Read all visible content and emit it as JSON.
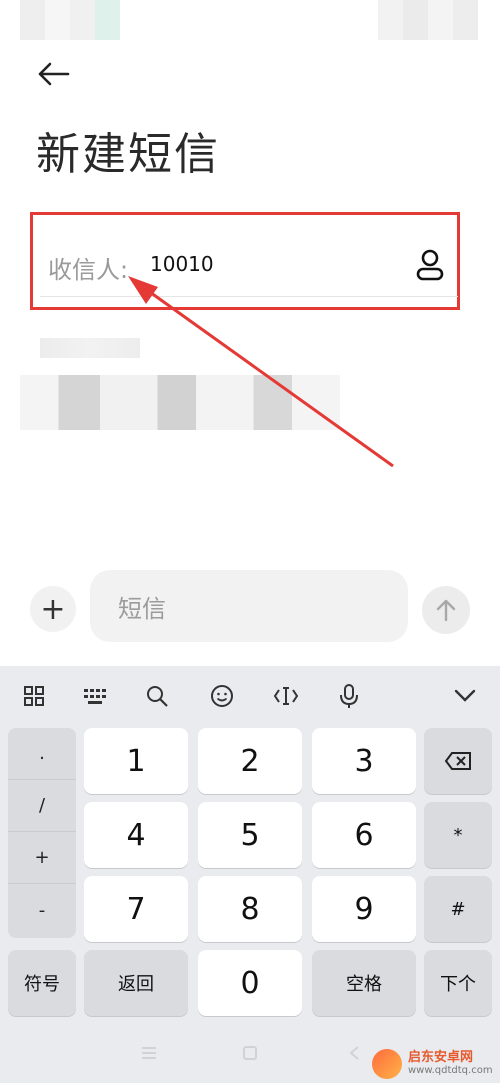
{
  "header": {
    "title": "新建短信"
  },
  "recipient": {
    "label": "收信人:",
    "value": "10010"
  },
  "composer": {
    "placeholder": "短信",
    "plus_label": "+"
  },
  "keyboard": {
    "symbols": [
      ".",
      "/",
      "+",
      "-"
    ],
    "digits": [
      "1",
      "2",
      "3",
      "4",
      "5",
      "6",
      "7",
      "8",
      "9"
    ],
    "right_keys": [
      "*",
      "#"
    ],
    "bottom": {
      "symbols": "符号",
      "back": "返回",
      "zero": "0",
      "space": "空格",
      "next": "下个"
    }
  },
  "watermark": {
    "name": "启东安卓网",
    "url": "www.qdtdtq.com"
  },
  "colors": {
    "highlight": "#e53935",
    "keyboard_bg": "#e9ebee"
  }
}
